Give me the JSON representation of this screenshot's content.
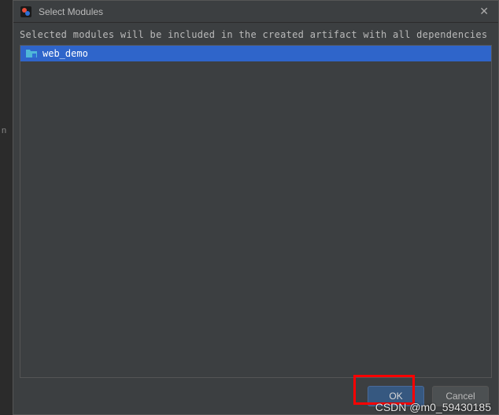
{
  "titlebar": {
    "title": "Select Modules"
  },
  "description": "Selected modules will be included in the created artifact with all dependencies",
  "modules": [
    {
      "label": "web_demo",
      "selected": true
    }
  ],
  "buttons": {
    "ok": "OK",
    "cancel": "Cancel"
  },
  "watermark": "CSDN @m0_59430185",
  "edge_hint": "n"
}
